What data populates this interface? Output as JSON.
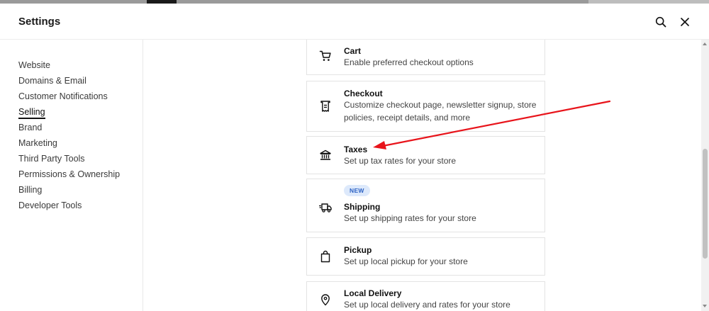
{
  "header": {
    "title": "Settings"
  },
  "sidebar": {
    "items": [
      {
        "label": "Website"
      },
      {
        "label": "Domains & Email"
      },
      {
        "label": "Customer Notifications"
      },
      {
        "label": "Selling",
        "active": true
      },
      {
        "label": "Brand"
      },
      {
        "label": "Marketing"
      },
      {
        "label": "Third Party Tools"
      },
      {
        "label": "Permissions & Ownership"
      },
      {
        "label": "Billing"
      },
      {
        "label": "Developer Tools"
      }
    ]
  },
  "cards": [
    {
      "icon": "cart-icon",
      "title": "Cart",
      "description": "Enable preferred checkout options"
    },
    {
      "icon": "checkout-icon",
      "title": "Checkout",
      "description": "Customize checkout page, newsletter signup, store policies, receipt details, and more"
    },
    {
      "icon": "bank-icon",
      "title": "Taxes",
      "description": "Set up tax rates for your store"
    },
    {
      "icon": "truck-icon",
      "title": "Shipping",
      "description": "Set up shipping rates for your store",
      "badge": "NEW"
    },
    {
      "icon": "bag-icon",
      "title": "Pickup",
      "description": "Set up local pickup for your store"
    },
    {
      "icon": "location-pin-icon",
      "title": "Local Delivery",
      "description": "Set up local delivery and rates for your store"
    }
  ],
  "colors": {
    "annotation_arrow": "#e8141b",
    "badge_bg": "#dde9fb",
    "badge_text": "#2d62c4"
  }
}
